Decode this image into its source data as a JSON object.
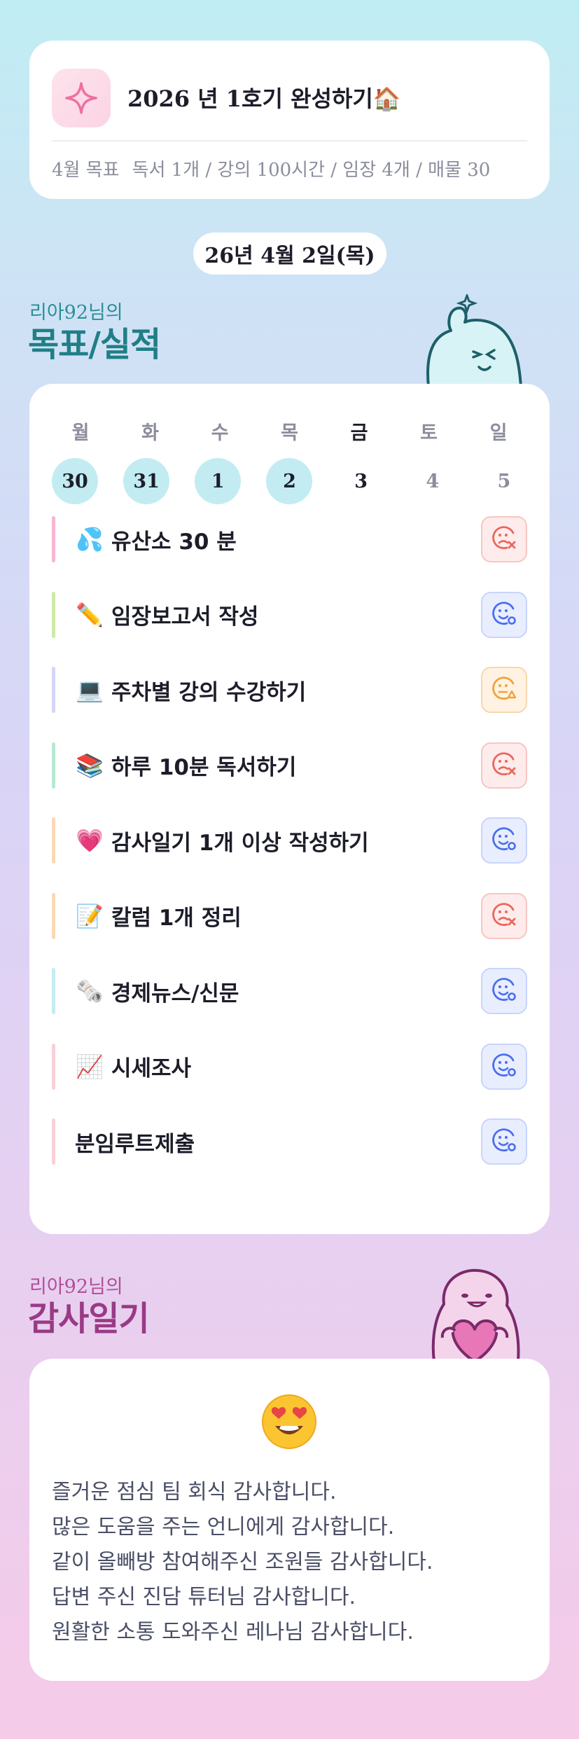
{
  "goal": {
    "title": "2026 년 1호기 완성하기🏠",
    "month_label": "4월 목표",
    "targets": "독서 1개 / 강의 100시간 / 임장 4개 / 매물 30"
  },
  "date_pill": "26년 4월 2일(목)",
  "tracker_section": {
    "subtitle": "리아92님의",
    "title": "목표/실적"
  },
  "week": {
    "days": [
      "월",
      "화",
      "수",
      "목",
      "금",
      "토",
      "일"
    ],
    "dates": [
      "30",
      "31",
      "1",
      "2",
      "3",
      "4",
      "5"
    ],
    "done": [
      true,
      true,
      true,
      true,
      false,
      false,
      false
    ],
    "today_index": 4
  },
  "tasks": [
    {
      "emoji": "💦",
      "label": "유산소 30 분",
      "status": "fail",
      "color": "#f7b6d3"
    },
    {
      "emoji": "✏️",
      "label": "임장보고서 작성",
      "status": "ok",
      "color": "#cfeaa7"
    },
    {
      "emoji": "💻",
      "label": "주차별 강의 수강하기",
      "status": "warn",
      "color": "#d3d6f5"
    },
    {
      "emoji": "📚",
      "label": "하루 10분 독서하기",
      "status": "fail",
      "color": "#b6ead1"
    },
    {
      "emoji": "💗",
      "label": "감사일기 1개 이상 작성하기",
      "status": "ok",
      "color": "#fbd8b5"
    },
    {
      "emoji": "📝",
      "label": "칼럼 1개 정리",
      "status": "fail",
      "color": "#fbd8b5"
    },
    {
      "emoji": "🗞️",
      "label": "경제뉴스/신문",
      "status": "ok",
      "color": "#c4ecf3"
    },
    {
      "emoji": "📈",
      "label": "시세조사",
      "status": "ok",
      "color": "#f9d0d6"
    },
    {
      "emoji": "",
      "label": "분임루트제출",
      "status": "ok",
      "color": "#f9d0d6"
    }
  ],
  "gratitude_section": {
    "subtitle": "리아92님의",
    "title": "감사일기"
  },
  "gratitude": {
    "emoji": "heart-eyes-face-icon",
    "lines": [
      "즐거운 점심 팀 회식 감사합니다.",
      "많은 도움을 주는 언니에게 감사합니다.",
      "같이 올빼방 참여해주신 조원들 감사합니다.",
      "답변 주신 진담 튜터님 감사합니다.",
      "원활한 소통 도와주신 레나님 감사합니다."
    ]
  },
  "colors": {
    "fail": "#e9675c",
    "ok": "#4a6ef0",
    "warn": "#f0a23a",
    "teal": "#1f7f86",
    "purple": "#9a3a86"
  }
}
